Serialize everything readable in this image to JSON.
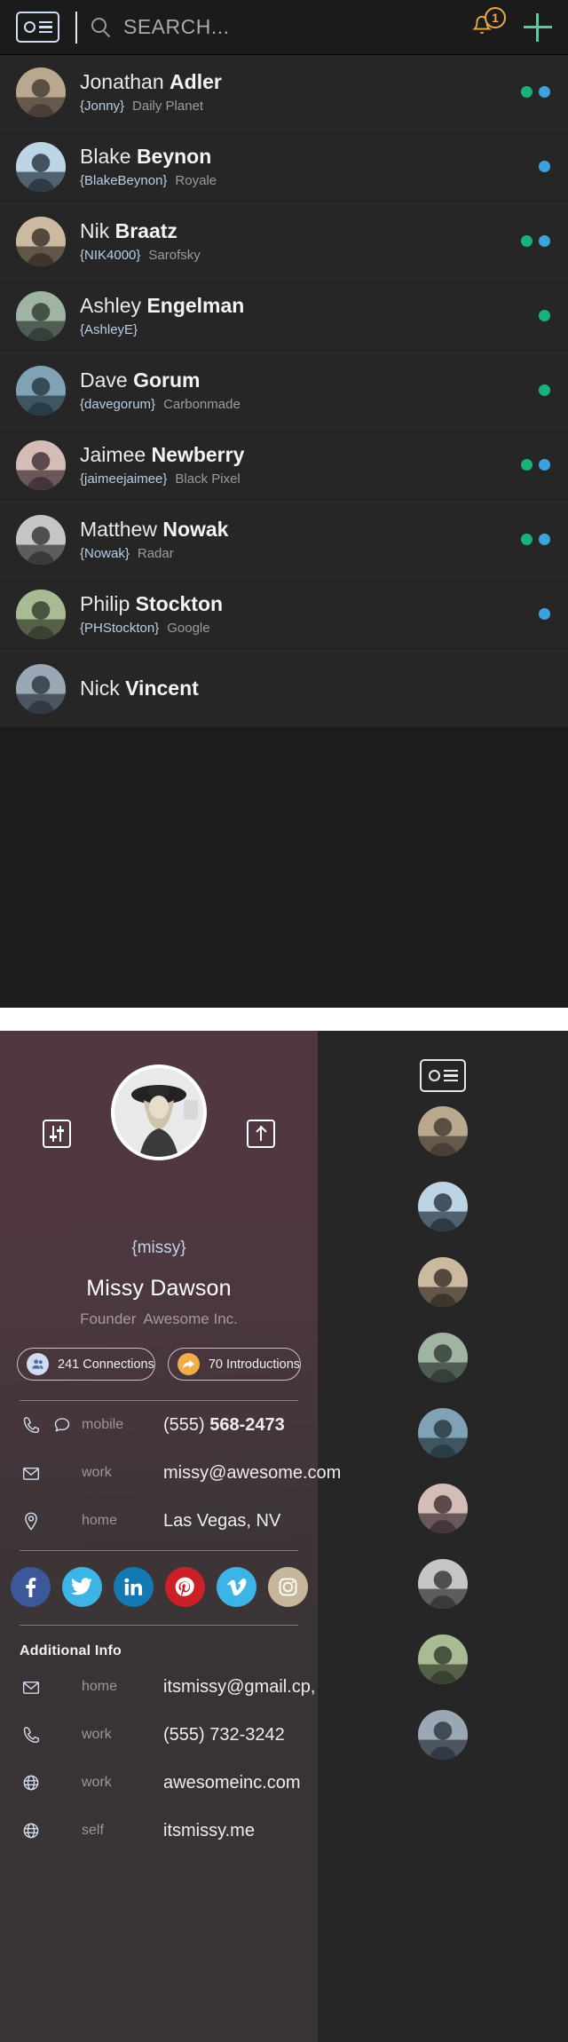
{
  "topbar": {
    "card_icon": "contact-card-icon",
    "search_placeholder": "SEARCH...",
    "search_value": "",
    "notification_icon": "bell-icon",
    "notification_count": "1",
    "add_icon": "plus-icon",
    "accent_green": "#4fcf9b",
    "accent_orange": "#efa84b",
    "accent_blue": "#cfe0f5"
  },
  "contacts": [
    {
      "first": "Jonathan",
      "last": "Adler",
      "handle": "{Jonny}",
      "company": "Daily Planet",
      "status": [
        "green",
        "blue"
      ]
    },
    {
      "first": "Blake",
      "last": "Beynon",
      "handle": "{BlakeBeynon}",
      "company": "Royale",
      "status": [
        "blue"
      ]
    },
    {
      "first": "Nik",
      "last": "Braatz",
      "handle": "{NIK4000}",
      "company": "Sarofsky",
      "status": [
        "green",
        "blue"
      ]
    },
    {
      "first": "Ashley",
      "last": "Engelman",
      "handle": "{AshleyE}",
      "company": "",
      "status": [
        "green"
      ]
    },
    {
      "first": "Dave",
      "last": "Gorum",
      "handle": "{davegorum}",
      "company": "Carbonmade",
      "status": [
        "green"
      ]
    },
    {
      "first": "Jaimee",
      "last": "Newberry",
      "handle": "{jaimeejaimee}",
      "company": "Black Pixel",
      "status": [
        "green",
        "blue"
      ]
    },
    {
      "first": "Matthew",
      "last": "Nowak",
      "handle": "{Nowak}",
      "company": "Radar",
      "status": [
        "green",
        "blue"
      ]
    },
    {
      "first": "Philip",
      "last": "Stockton",
      "handle": "{PHStockton}",
      "company": "Google",
      "status": [
        "blue"
      ]
    },
    {
      "first": "Nick",
      "last": "Vincent",
      "handle": "",
      "company": "",
      "status": []
    }
  ],
  "profile": {
    "settings_icon": "sliders-icon",
    "share_icon": "share-icon",
    "avatar_alt": "profile-photo",
    "handle": "{missy}",
    "name": "Missy Dawson",
    "role": "Founder",
    "company": "Awesome Inc.",
    "pills": [
      {
        "icon": "people-icon",
        "label": "241 Connections"
      },
      {
        "icon": "introduction-icon",
        "label": "70 Introductions"
      }
    ],
    "contact_rows": [
      {
        "icon": "phone-icon",
        "icon2": "chat-icon",
        "type": "mobile",
        "value": "(555) 568-2473",
        "bold_from": 6
      },
      {
        "icon": "envelope-icon",
        "icon2": "",
        "type": "work",
        "value": "missy@awesome.com"
      },
      {
        "icon": "pin-icon",
        "icon2": "",
        "type": "home",
        "value": "Las Vegas, NV"
      }
    ],
    "socials": [
      {
        "name": "facebook-icon",
        "glyph": "f",
        "color": "#3b5998"
      },
      {
        "name": "twitter-icon",
        "glyph": "t",
        "color": "#3cb4e5"
      },
      {
        "name": "linkedin-icon",
        "glyph": "in",
        "color": "#1279b3"
      },
      {
        "name": "pinterest-icon",
        "glyph": "P",
        "color": "#cb2027"
      },
      {
        "name": "vimeo-icon",
        "glyph": "V",
        "color": "#3cb4e5"
      },
      {
        "name": "instagram-icon",
        "glyph": "o",
        "color": "#c6b79a"
      }
    ],
    "additional_title": "Additional Info",
    "additional_rows": [
      {
        "icon": "envelope-icon",
        "type": "home",
        "value": "itsmissy@gmail.cp,"
      },
      {
        "icon": "phone-icon",
        "type": "work",
        "value": "(555) 732-3242"
      },
      {
        "icon": "globe-icon",
        "type": "work",
        "value": "awesomeinc.com"
      },
      {
        "icon": "globe-icon",
        "type": "self",
        "value": "itsmissy.me"
      }
    ]
  },
  "rail": {
    "card_icon": "contact-card-icon",
    "thumbs": [
      "thumb-1",
      "thumb-2",
      "thumb-3",
      "thumb-4",
      "thumb-5",
      "thumb-6",
      "thumb-7",
      "thumb-8",
      "thumb-9"
    ]
  }
}
